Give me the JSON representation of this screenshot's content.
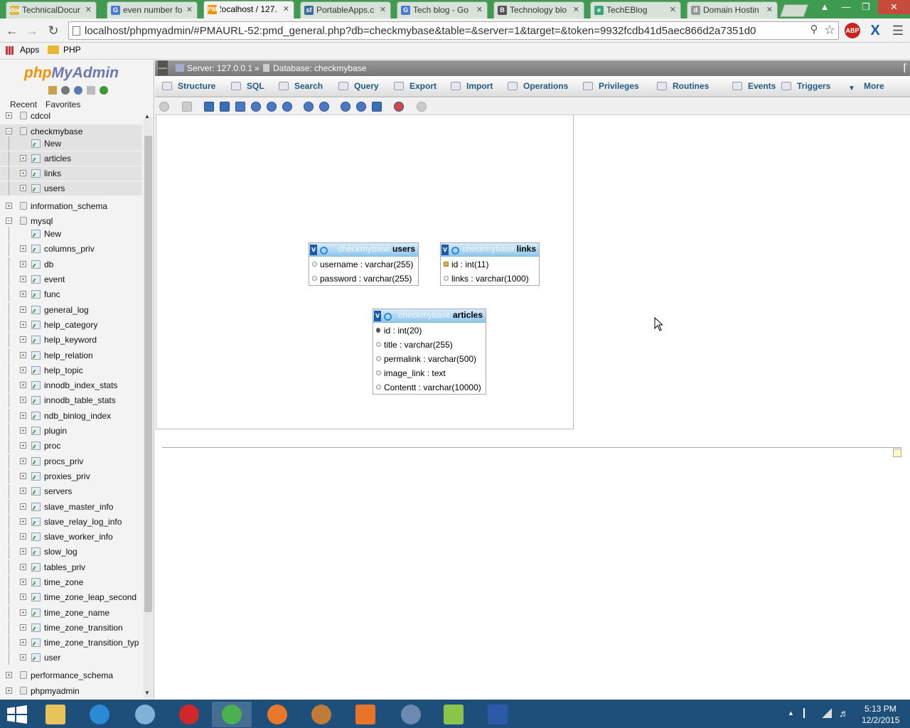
{
  "browser": {
    "tabs": [
      {
        "title": "TechnicalDocur",
        "fav": "doc",
        "color": "#e0b34a"
      },
      {
        "title": "even number fo",
        "fav": "G",
        "color": "#4a7bd0"
      },
      {
        "title": "localhost / 127.",
        "fav": "PMA",
        "color": "#f29200"
      },
      {
        "title": "PortableApps.c",
        "fav": "sf",
        "color": "#3a6e9a"
      },
      {
        "title": "Tech blog - Go",
        "fav": "G",
        "color": "#4a7bd0"
      },
      {
        "title": "Technology blo",
        "fav": "B",
        "color": "#555"
      },
      {
        "title": "TechEBlog",
        "fav": "e",
        "color": "#3aa37a"
      },
      {
        "title": "Domain Hostin",
        "fav": "d",
        "color": "#999"
      }
    ],
    "url": "localhost/phpmyadmin/#PMAURL-52:pmd_general.php?db=checkmybase&table=&server=1&target=&token=9932fcdb41d5aec866d2a7351d0",
    "bookmarks": {
      "apps": "Apps",
      "php": "PHP"
    }
  },
  "sidebar": {
    "logo_left": "php",
    "logo_right": "MyAdmin",
    "recent": "Recent",
    "favorites": "Favorites",
    "tree": [
      {
        "label": "cdcol",
        "level": 0
      },
      {
        "label": "checkmybase",
        "level": 0,
        "expanded": true
      },
      {
        "label": "New",
        "level": 1,
        "new": true
      },
      {
        "label": "articles",
        "level": 1
      },
      {
        "label": "links",
        "level": 1
      },
      {
        "label": "users",
        "level": 1
      },
      {
        "label": "information_schema",
        "level": 0
      },
      {
        "label": "mysql",
        "level": 0,
        "expanded": true
      },
      {
        "label": "New",
        "level": 1,
        "new": true
      },
      {
        "label": "columns_priv",
        "level": 1
      },
      {
        "label": "db",
        "level": 1
      },
      {
        "label": "event",
        "level": 1
      },
      {
        "label": "func",
        "level": 1
      },
      {
        "label": "general_log",
        "level": 1
      },
      {
        "label": "help_category",
        "level": 1
      },
      {
        "label": "help_keyword",
        "level": 1
      },
      {
        "label": "help_relation",
        "level": 1
      },
      {
        "label": "help_topic",
        "level": 1
      },
      {
        "label": "innodb_index_stats",
        "level": 1
      },
      {
        "label": "innodb_table_stats",
        "level": 1
      },
      {
        "label": "ndb_binlog_index",
        "level": 1
      },
      {
        "label": "plugin",
        "level": 1
      },
      {
        "label": "proc",
        "level": 1
      },
      {
        "label": "procs_priv",
        "level": 1
      },
      {
        "label": "proxies_priv",
        "level": 1
      },
      {
        "label": "servers",
        "level": 1
      },
      {
        "label": "slave_master_info",
        "level": 1
      },
      {
        "label": "slave_relay_log_info",
        "level": 1
      },
      {
        "label": "slave_worker_info",
        "level": 1
      },
      {
        "label": "slow_log",
        "level": 1
      },
      {
        "label": "tables_priv",
        "level": 1
      },
      {
        "label": "time_zone",
        "level": 1
      },
      {
        "label": "time_zone_leap_second",
        "level": 1
      },
      {
        "label": "time_zone_name",
        "level": 1
      },
      {
        "label": "time_zone_transition",
        "level": 1
      },
      {
        "label": "time_zone_transition_typ",
        "level": 1
      },
      {
        "label": "user",
        "level": 1
      },
      {
        "label": "performance_schema",
        "level": 0
      },
      {
        "label": "phpmyadmin",
        "level": 0
      }
    ]
  },
  "breadcrumb": {
    "server": "Server: 127.0.0.1",
    "sep": "»",
    "database": "Database: checkmybase"
  },
  "menu": [
    "Structure",
    "SQL",
    "Search",
    "Query",
    "Export",
    "Import",
    "Operations",
    "Privileges",
    "Routines",
    "Events",
    "Triggers",
    "More"
  ],
  "designer": {
    "tables": [
      {
        "db": "checkmybase.",
        "name": "users",
        "columns": [
          {
            "icon": "dot",
            "text": "username : varchar(255)"
          },
          {
            "icon": "dot",
            "text": "password : varchar(255)"
          }
        ]
      },
      {
        "db": "checkmybase.",
        "name": "links",
        "columns": [
          {
            "icon": "key",
            "text": "id : int(11)"
          },
          {
            "icon": "dot",
            "text": "links : varchar(1000)"
          }
        ]
      },
      {
        "db": "checkmybase.",
        "name": "articles",
        "columns": [
          {
            "icon": "hash",
            "text": "id : int(20)"
          },
          {
            "icon": "dot",
            "text": "title : varchar(255)"
          },
          {
            "icon": "dot",
            "text": "permalink : varchar(500)"
          },
          {
            "icon": "dot",
            "text": "image_link : text"
          },
          {
            "icon": "dot",
            "text": "Contentt : varchar(10000)"
          }
        ]
      }
    ]
  },
  "taskbar": {
    "time": "5:13 PM",
    "date": "12/2/2015",
    "apps": [
      {
        "name": "file-explorer",
        "color": "#e8c25a"
      },
      {
        "name": "internet-explorer",
        "color": "#2a8ad4"
      },
      {
        "name": "safari",
        "color": "#7fb2d8"
      },
      {
        "name": "opera",
        "color": "#d0282a"
      },
      {
        "name": "chrome",
        "color": "#4caf50"
      },
      {
        "name": "firefox",
        "color": "#e8782a"
      },
      {
        "name": "notepad",
        "color": "#c07a3a"
      },
      {
        "name": "xampp",
        "color": "#e8742a"
      },
      {
        "name": "home",
        "color": "#6a8ab0"
      },
      {
        "name": "notepad-plus",
        "color": "#8ac44a"
      },
      {
        "name": "word",
        "color": "#2a5aa8"
      }
    ]
  }
}
